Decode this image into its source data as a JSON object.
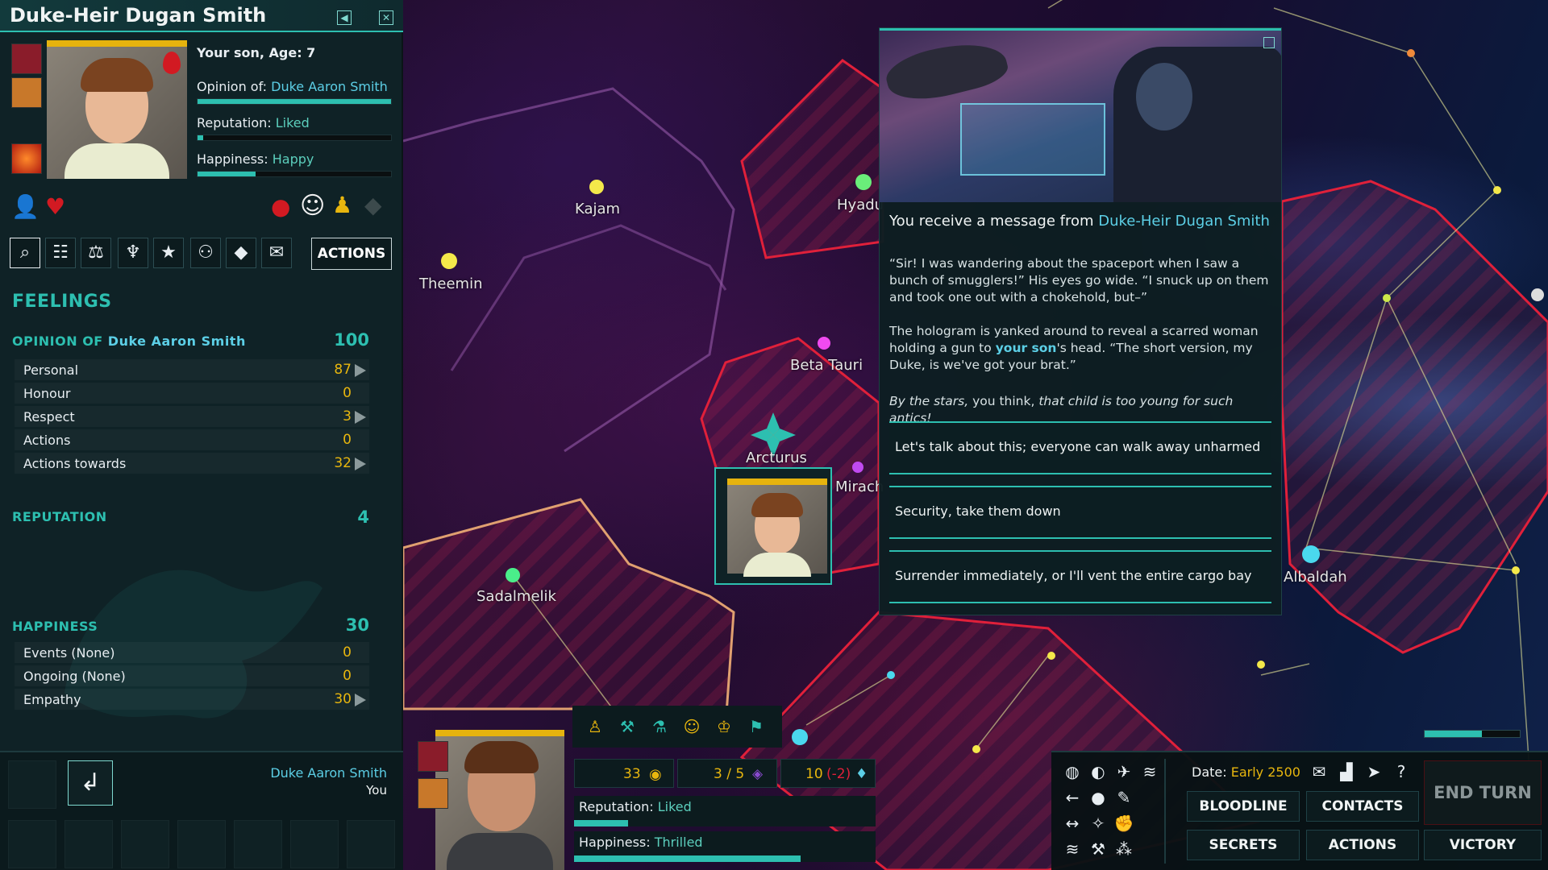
{
  "character": {
    "title": "Duke-Heir Dugan Smith",
    "relation": "Your son, Age: 7",
    "opinion_label": "Opinion of:",
    "opinion_target": "Duke Aaron Smith",
    "reputation_label": "Reputation:",
    "reputation_value": "Liked",
    "happiness_label": "Happiness:",
    "happiness_value": "Happy",
    "opinion_bar": 1.0,
    "reputation_bar": 0.03,
    "happiness_bar": 0.3
  },
  "tabs": {
    "actions_label": "ACTIONS"
  },
  "feelings": {
    "heading": "FEELINGS",
    "opinion_prefix": "OPINION OF",
    "opinion_target": "Duke Aaron Smith",
    "opinion_total": "100",
    "rows": [
      {
        "label": "Personal",
        "value": "87"
      },
      {
        "label": "Honour",
        "value": "0"
      },
      {
        "label": "Respect",
        "value": "3"
      },
      {
        "label": "Actions",
        "value": "0"
      },
      {
        "label": "Actions towards",
        "value": "32"
      }
    ]
  },
  "reputation": {
    "heading": "REPUTATION",
    "value": "4"
  },
  "happiness": {
    "heading": "HAPPINESS",
    "value": "30",
    "rows": [
      {
        "label": "Events (None)",
        "value": "0"
      },
      {
        "label": "Ongoing (None)",
        "value": "0"
      },
      {
        "label": "Empathy",
        "value": "30"
      }
    ]
  },
  "bottom_left": {
    "name": "Duke Aaron Smith",
    "sub": "You"
  },
  "message": {
    "heading_prefix": "You receive a message from",
    "heading_sender": "Duke-Heir Dugan Smith",
    "para1": "“Sir! I was wandering about the spaceport when I saw a bunch of smugglers!” His eyes go wide. “I snuck up on them and took one out with a chokehold, but–”",
    "para2_a": "The hologram is yanked around to reveal a scarred woman holding a gun to",
    "para2_link": "your son",
    "para2_b": "'s head. “The short version, my Duke, is we've got your brat.”",
    "para3_a": "By the stars,",
    "para3_b": "you think,",
    "para3_c": "that child is too young for such antics!",
    "choices": [
      "Let's talk about this; everyone can walk away unharmed",
      "Security, take them down",
      "Surrender immediately, or I'll vent the entire cargo bay"
    ]
  },
  "map": {
    "systems": [
      "Kajam",
      "Theemin",
      "Hyadu",
      "Beta Tauri",
      "Arcturus",
      "Mirach",
      "Sadalmelik",
      "Albaldah"
    ]
  },
  "ruler": {
    "money": "33",
    "slots": "3 / 5",
    "influence": "10",
    "influence_delta": "(-2)",
    "reputation_label": "Reputation:",
    "reputation_value": "Liked",
    "happiness_label": "Happiness:",
    "happiness_value": "Thrilled",
    "reputation_bar": 0.18,
    "happiness_bar": 0.75
  },
  "hud": {
    "date_label": "Date:",
    "date_value": "Early 2500",
    "buttons": [
      "BLOODLINE",
      "CONTACTS",
      "SECRETS",
      "ACTIONS",
      "VICTORY"
    ],
    "end_turn": "END TURN",
    "help": "?"
  },
  "colors": {
    "accent": "#2dbfb0",
    "link": "#5ccfe6",
    "gold": "#e8b60e",
    "border_red": "#e0203a"
  }
}
